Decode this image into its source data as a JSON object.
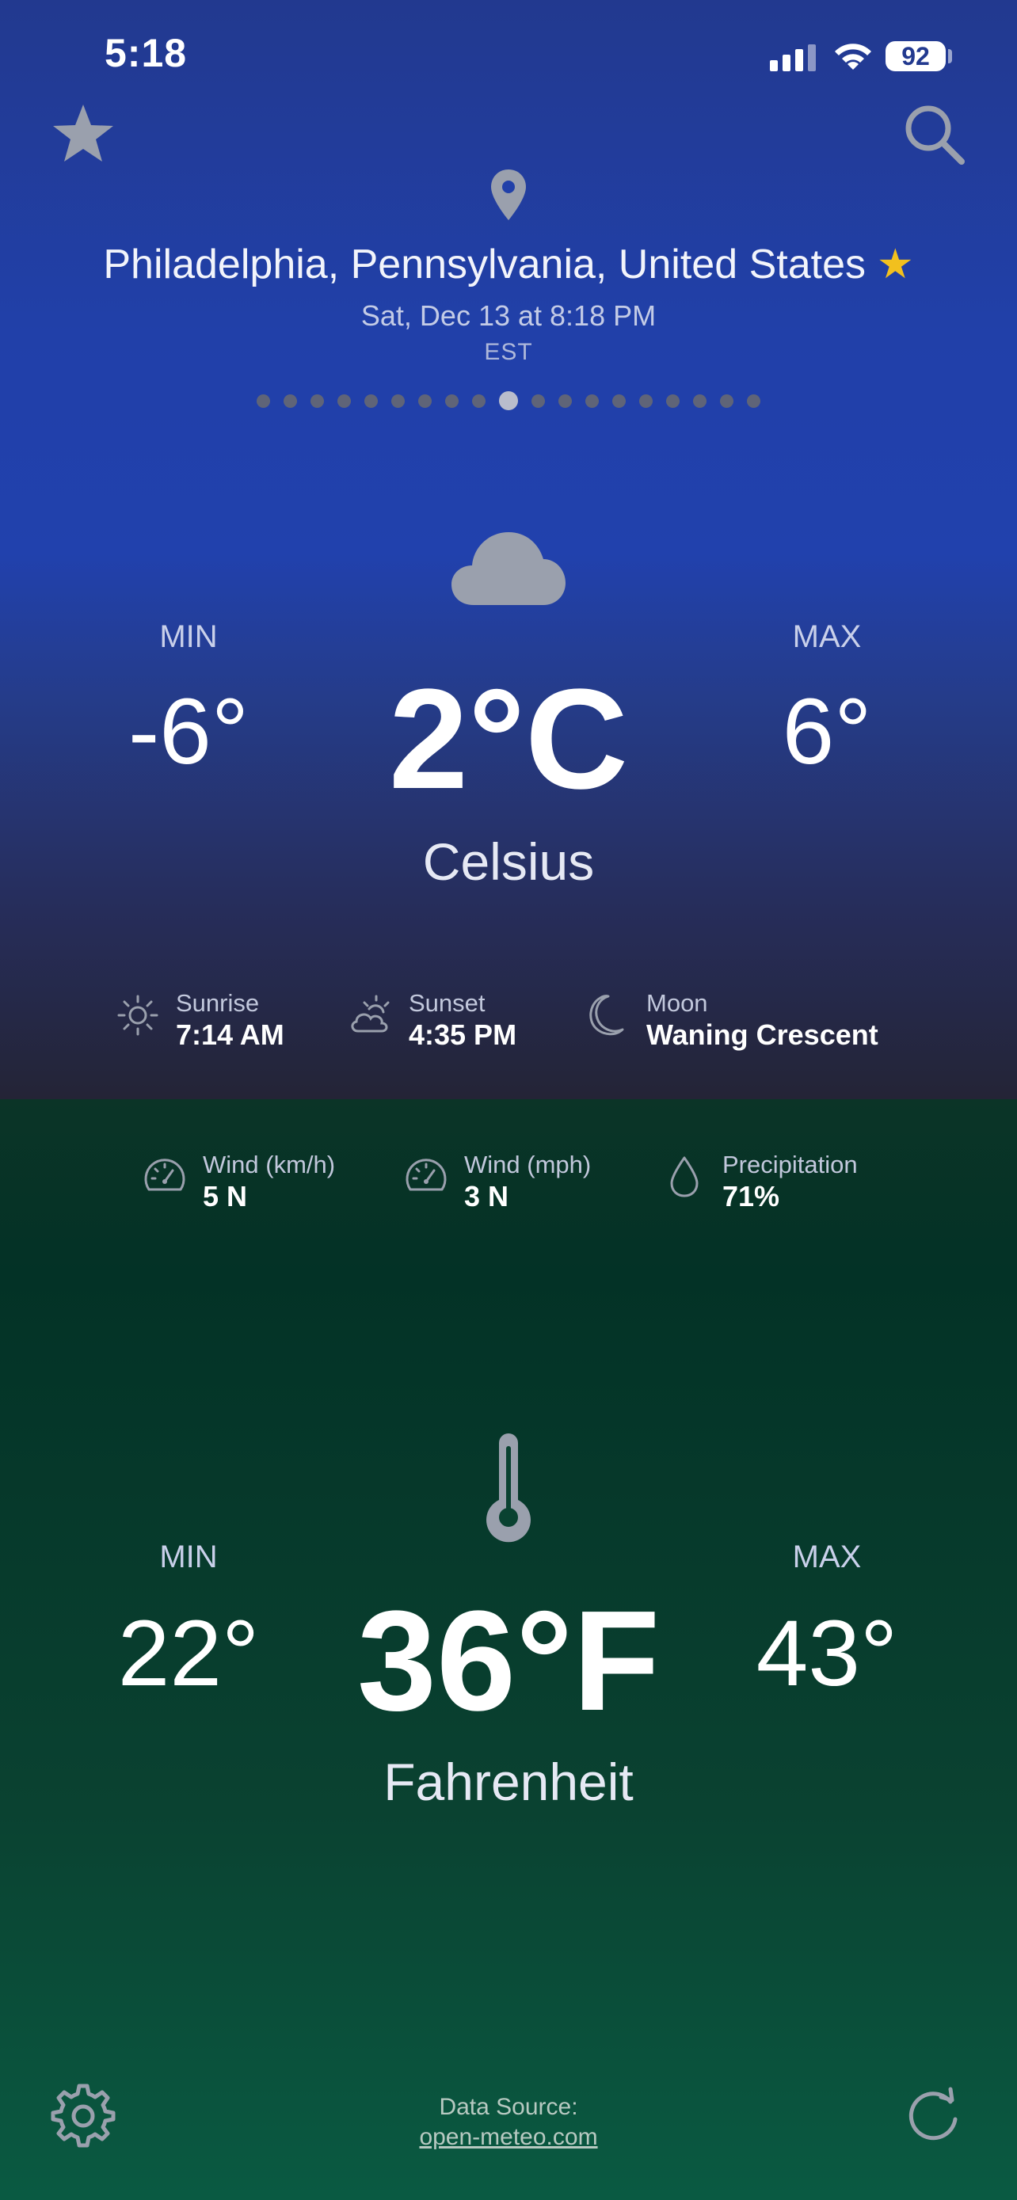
{
  "status_bar": {
    "time": "5:18",
    "battery": "92"
  },
  "header": {
    "location": "Philadelphia, Pennsylvania, United States",
    "favorite_star": "★",
    "date_time": "Sat, Dec 13 at 8:18 PM",
    "timezone": "EST",
    "page_count": 19,
    "active_page": 9
  },
  "celsius": {
    "min_label": "MIN",
    "min_value": "-6°",
    "max_label": "MAX",
    "max_value": "6°",
    "current": "2°C",
    "unit_name": "Celsius",
    "condition_icon": "cloud-icon"
  },
  "astro": [
    {
      "icon": "sun-icon",
      "label": "Sunrise",
      "value": "7:14 AM"
    },
    {
      "icon": "partly-cloudy-icon",
      "label": "Sunset",
      "value": "4:35 PM"
    },
    {
      "icon": "moon-icon",
      "label": "Moon",
      "value": "Waning Crescent"
    }
  ],
  "conditions": [
    {
      "icon": "speedometer-icon",
      "label": "Wind (km/h)",
      "value": "5 N"
    },
    {
      "icon": "speedometer-icon",
      "label": "Wind (mph)",
      "value": "3 N"
    },
    {
      "icon": "droplet-icon",
      "label": "Precipitation",
      "value": "71%"
    }
  ],
  "fahrenheit": {
    "min_label": "MIN",
    "min_value": "22°",
    "max_label": "MAX",
    "max_value": "43°",
    "current": "36°F",
    "unit_name": "Fahrenheit",
    "condition_icon": "thermometer-icon"
  },
  "footer": {
    "source_label": "Data Source:",
    "source_link": "open-meteo.com"
  },
  "colors": {
    "top_background": "#2141ad",
    "bottom_background": "#0a4231",
    "favorite_star": "#f2c01e",
    "icon_gray": "#9aa0ad"
  }
}
